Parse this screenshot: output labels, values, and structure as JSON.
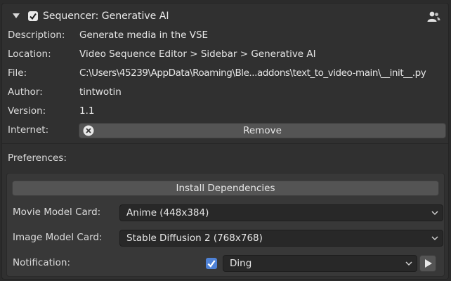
{
  "addon": {
    "title": "Sequencer: Generative AI",
    "enabled": true,
    "info": [
      {
        "label": "Description:",
        "value": "Generate media in the VSE"
      },
      {
        "label": "Location:",
        "value": "Video Sequence Editor > Sidebar > Generative AI"
      },
      {
        "label": "File:",
        "value": "C:\\Users\\45239\\AppData\\Roaming\\Ble...addons\\text_to_video-main\\__init__.py"
      },
      {
        "label": "Author:",
        "value": "tintwotin"
      },
      {
        "label": "Version:",
        "value": "1.1"
      }
    ],
    "internet_label": "Internet:",
    "remove_label": "Remove"
  },
  "preferences": {
    "label": "Preferences:",
    "install_label": "Install Dependencies",
    "movie_model": {
      "label": "Movie Model Card:",
      "value": "Anime (448x384)"
    },
    "image_model": {
      "label": "Image Model Card:",
      "value": "Stable Diffusion 2 (768x768)"
    },
    "notification": {
      "label": "Notification:",
      "enabled": true,
      "sound": "Ding"
    }
  },
  "icons": {
    "expand": "triangle-down-icon",
    "checkbox": "checkbox-icon",
    "user": "user-icon",
    "remove": "x-circle-icon",
    "dropdown": "chevron-down-icon",
    "play": "play-icon"
  },
  "colors": {
    "background": "#303030",
    "checkbox_accent": "#4f82d6",
    "button": "#545454",
    "field": "#282828"
  }
}
